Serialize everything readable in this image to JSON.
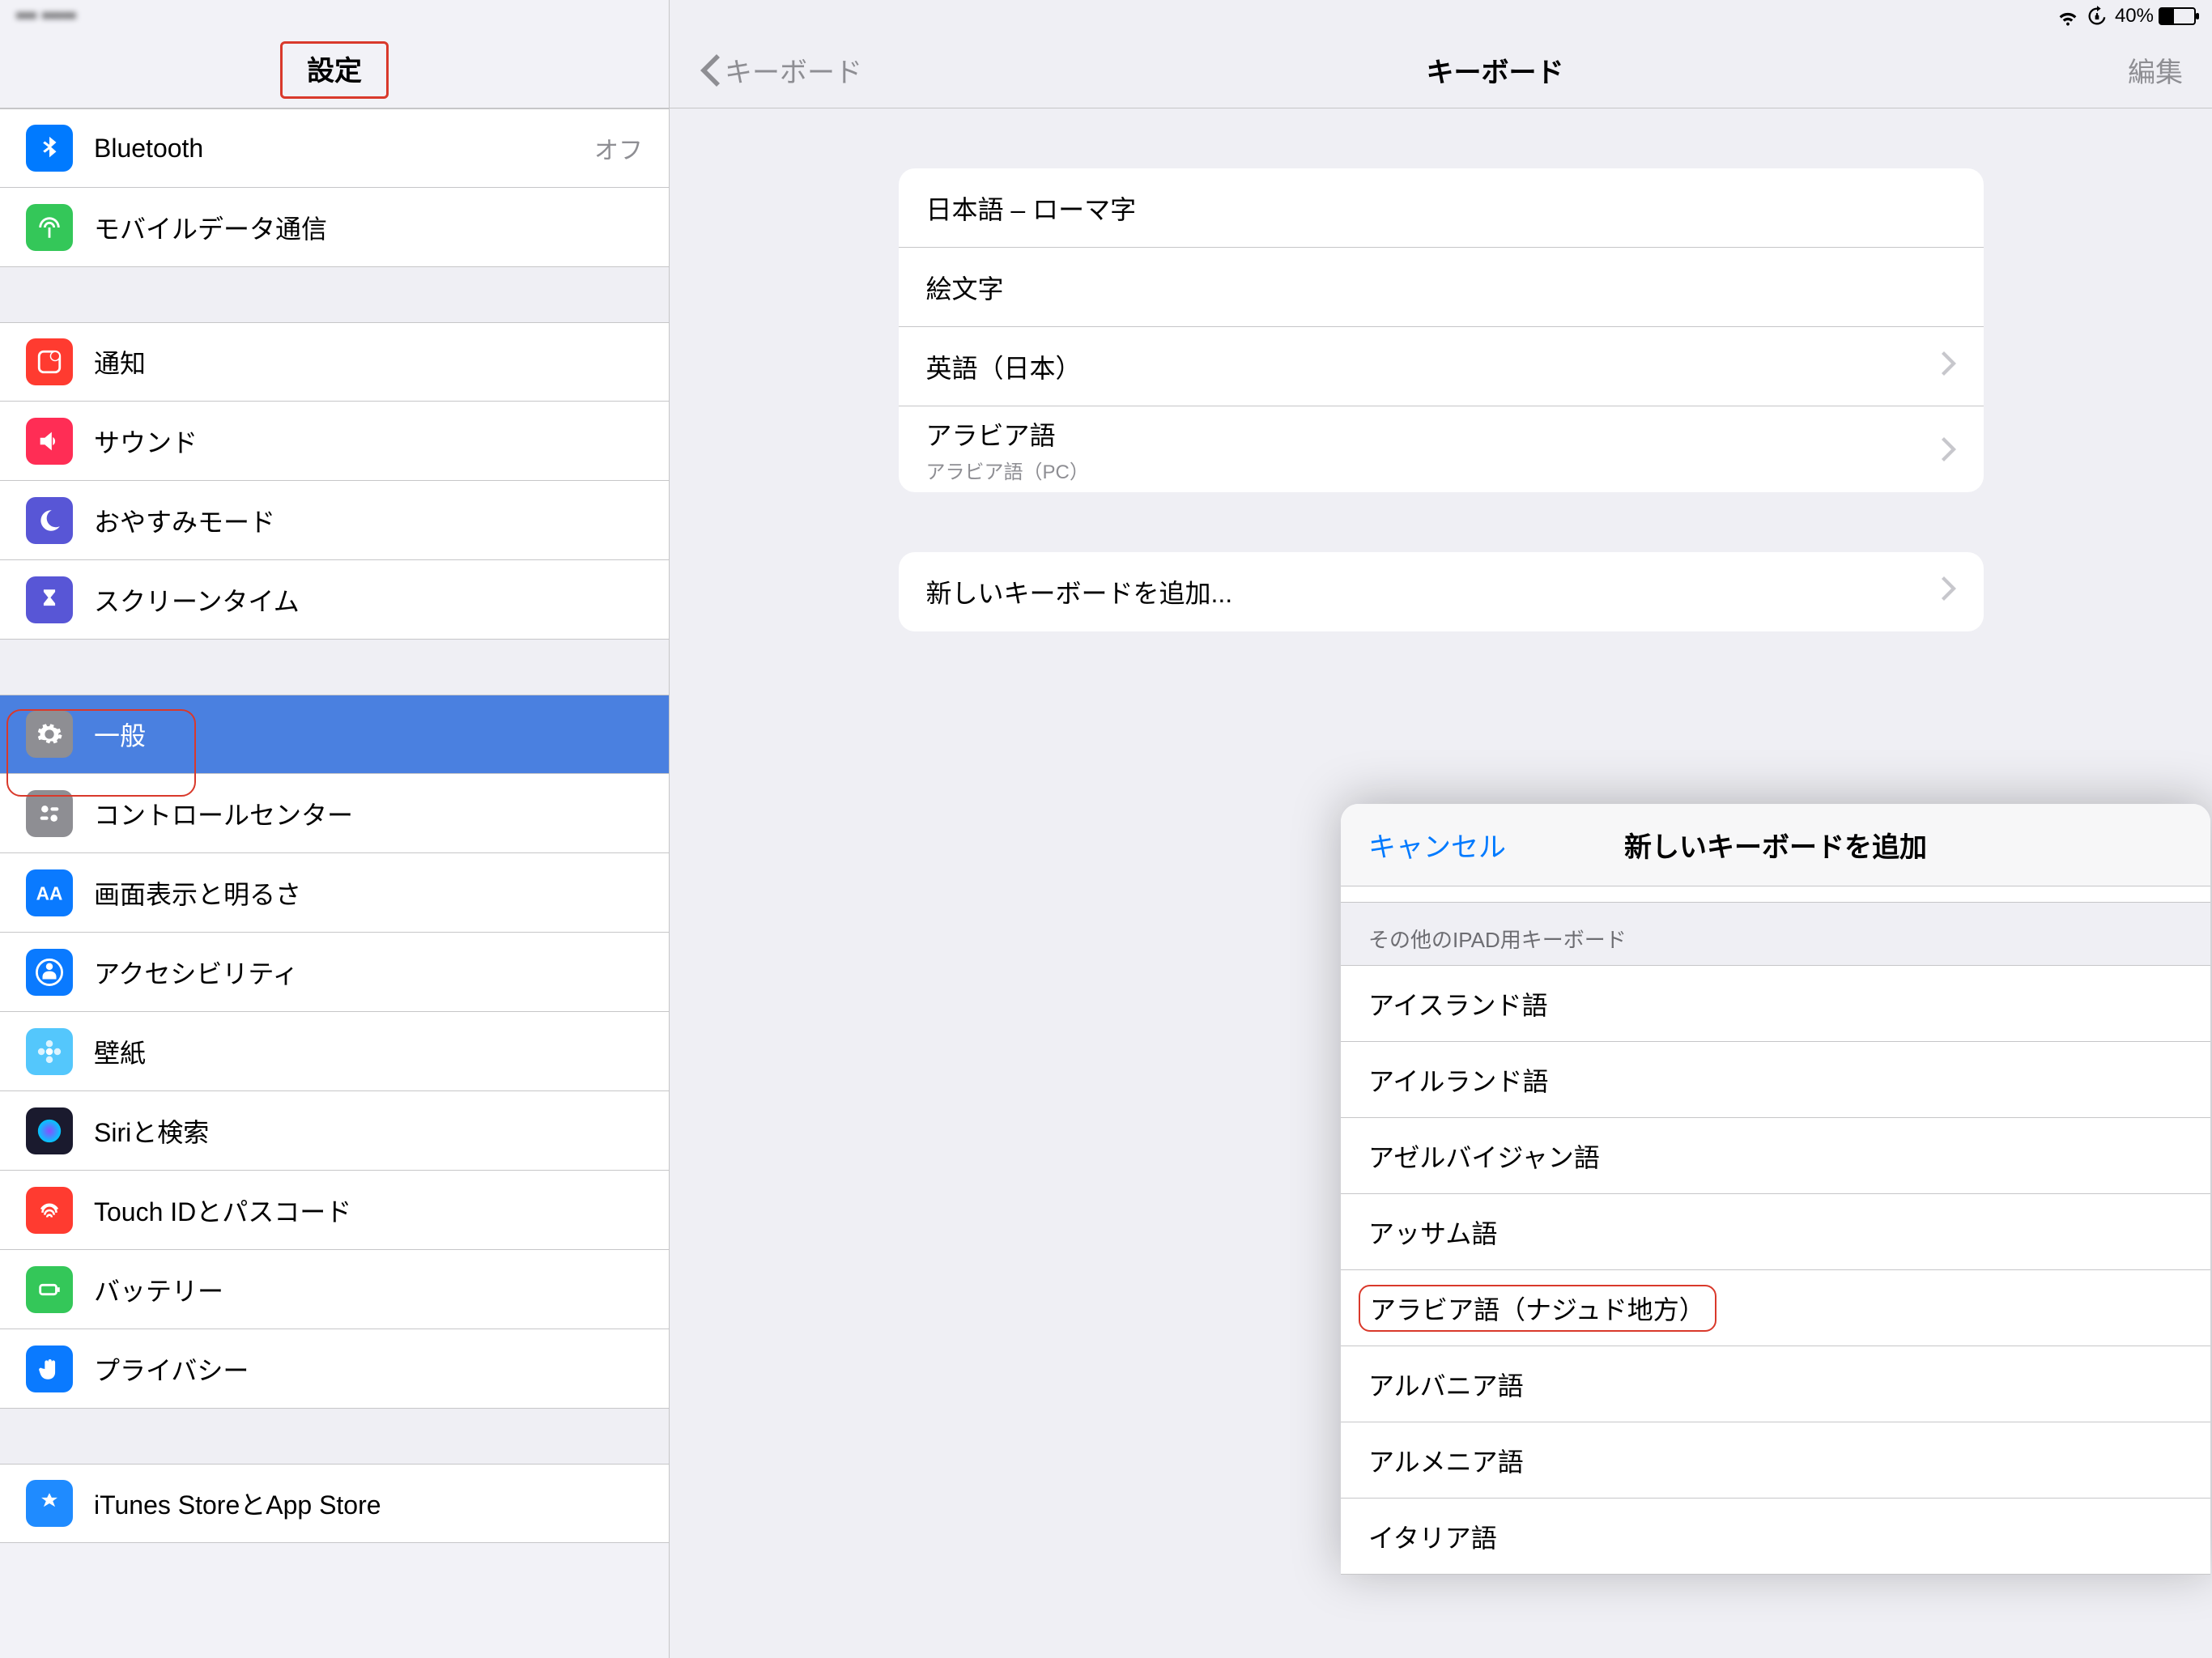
{
  "status": {
    "carrier_blurred": "••• •••••",
    "battery_pct": "40%"
  },
  "sidebar": {
    "title": "設定",
    "items": [
      {
        "label": "Bluetooth",
        "right": "オフ",
        "icon": "bluetooth",
        "color": "#007aff"
      },
      {
        "label": "モバイルデータ通信",
        "icon": "antenna",
        "color": "#34c759"
      }
    ],
    "group2": [
      {
        "label": "通知",
        "icon": "notification",
        "color": "#ff3b30"
      },
      {
        "label": "サウンド",
        "icon": "speaker",
        "color": "#ff2d55"
      },
      {
        "label": "おやすみモード",
        "icon": "moon",
        "color": "#5856d6"
      },
      {
        "label": "スクリーンタイム",
        "icon": "hourglass",
        "color": "#5856d6"
      }
    ],
    "group3": [
      {
        "label": "一般",
        "icon": "gear",
        "color": "#8e8e93",
        "selected": true
      },
      {
        "label": "コントロールセンター",
        "icon": "switches",
        "color": "#8e8e93"
      },
      {
        "label": "画面表示と明るさ",
        "icon": "aa",
        "color": "#0a7aff"
      },
      {
        "label": "アクセシビリティ",
        "icon": "person",
        "color": "#0a7aff"
      },
      {
        "label": "壁紙",
        "icon": "flower",
        "color": "#54c7fc"
      },
      {
        "label": "Siriと検索",
        "icon": "siri",
        "color": "#1a1a2e"
      },
      {
        "label": "Touch IDとパスコード",
        "icon": "fingerprint",
        "color": "#ff3b30"
      },
      {
        "label": "バッテリー",
        "icon": "battery",
        "color": "#34c759"
      },
      {
        "label": "プライバシー",
        "icon": "hand",
        "color": "#0a7aff"
      }
    ],
    "group4": [
      {
        "label": "iTunes StoreとApp Store",
        "icon": "appstore",
        "color": "#1f8bff"
      }
    ]
  },
  "main": {
    "back": "キーボード",
    "title": "キーボード",
    "edit": "編集",
    "keyboards": [
      {
        "label": "日本語 – ローマ字"
      },
      {
        "label": "絵文字"
      },
      {
        "label": "英語（日本）",
        "chevron": true
      },
      {
        "label": "アラビア語",
        "sub": "アラビア語（PC）",
        "chevron": true
      }
    ],
    "add_label": "新しいキーボードを追加..."
  },
  "modal": {
    "cancel": "キャンセル",
    "title": "新しいキーボードを追加",
    "section": "その他のIPAD用キーボード",
    "rows": [
      "アイスランド語",
      "アイルランド語",
      "アゼルバイジャン語",
      "アッサム語",
      "アラビア語（ナジュド地方）",
      "アルバニア語",
      "アルメニア語",
      "イタリア語"
    ],
    "highlight_index": 4
  }
}
